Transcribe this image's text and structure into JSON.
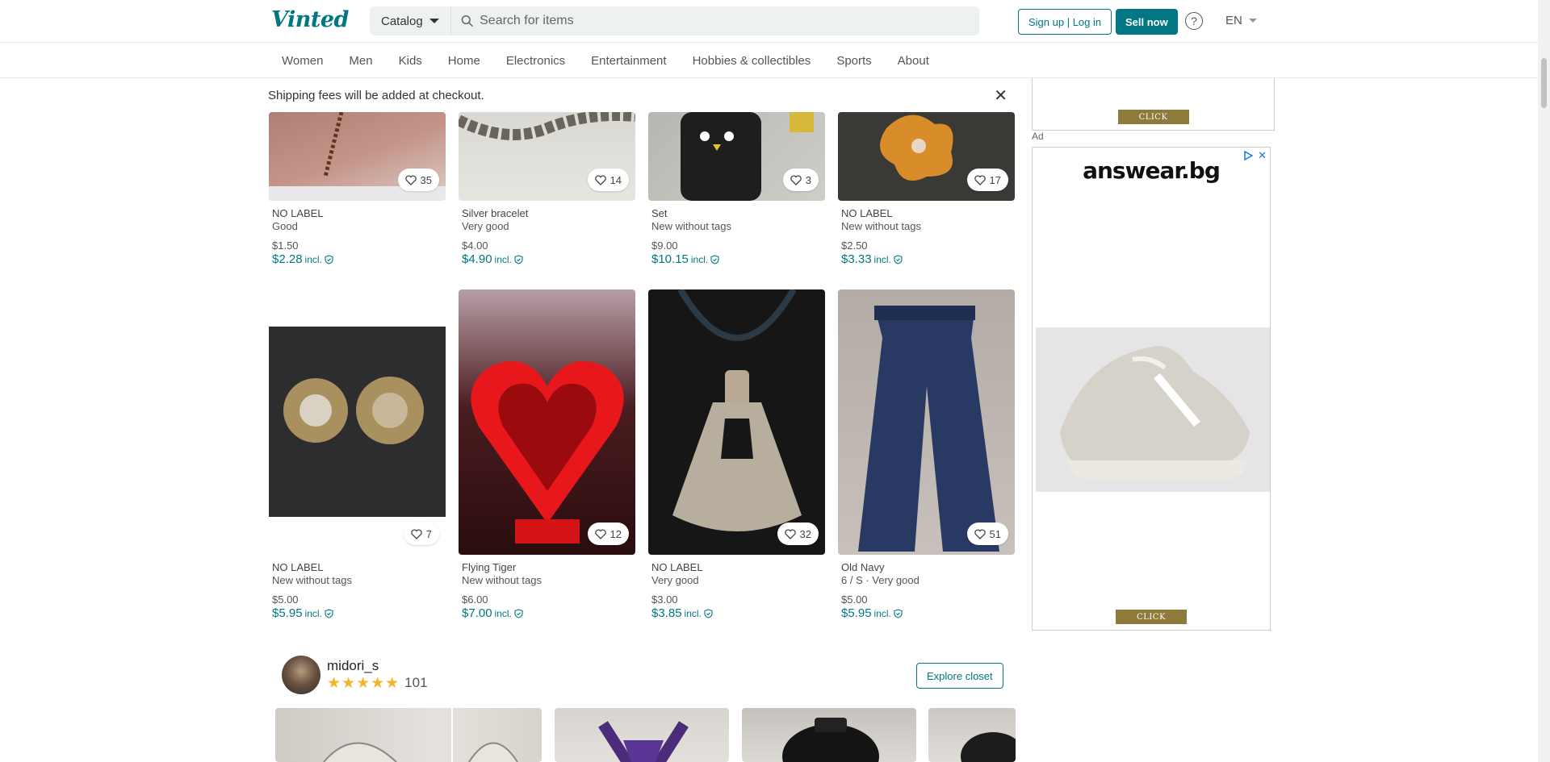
{
  "header": {
    "logo": "Vinted",
    "catalog_label": "Catalog",
    "search_placeholder": "Search for items",
    "auth_label": "Sign up | Log in",
    "sell_label": "Sell now",
    "help": "?",
    "language": "EN"
  },
  "nav": [
    "Women",
    "Men",
    "Kids",
    "Home",
    "Electronics",
    "Entertainment",
    "Hobbies & collectibles",
    "Sports",
    "About"
  ],
  "notice": "Shipping fees will be added at checkout.",
  "incl_label": "incl.",
  "row1": [
    {
      "favs": "35",
      "brand": "NO LABEL",
      "cond": "Good",
      "price": "$1.50",
      "incl": "$2.28"
    },
    {
      "favs": "14",
      "brand": "Silver bracelet",
      "cond": "Very good",
      "price": "$4.00",
      "incl": "$4.90"
    },
    {
      "favs": "3",
      "brand": "Set",
      "cond": "New without tags",
      "price": "$9.00",
      "incl": "$10.15"
    },
    {
      "favs": "17",
      "brand": "NO LABEL",
      "cond": "New without tags",
      "price": "$2.50",
      "incl": "$3.33"
    }
  ],
  "row2": [
    {
      "favs": "7",
      "brand": "NO LABEL",
      "cond": "New without tags",
      "price": "$5.00",
      "incl": "$5.95"
    },
    {
      "favs": "12",
      "brand": "Flying Tiger",
      "cond": "New without tags",
      "price": "$6.00",
      "incl": "$7.00"
    },
    {
      "favs": "32",
      "brand": "NO LABEL",
      "cond": "Very good",
      "price": "$3.00",
      "incl": "$3.85"
    },
    {
      "favs": "51",
      "brand": "Old Navy",
      "cond": "6 / S · Very good",
      "price": "$5.00",
      "incl": "$5.95"
    }
  ],
  "seller": {
    "name": "midori_s",
    "stars": "★★★★★",
    "reviews": "101",
    "explore_label": "Explore closet"
  },
  "ad": {
    "label": "Ad",
    "click": "CLICK",
    "logo": "answear.bg"
  },
  "colors": {
    "brand": "#007782",
    "star": "#f3b52b",
    "ad_button": "#8e7a3a"
  }
}
